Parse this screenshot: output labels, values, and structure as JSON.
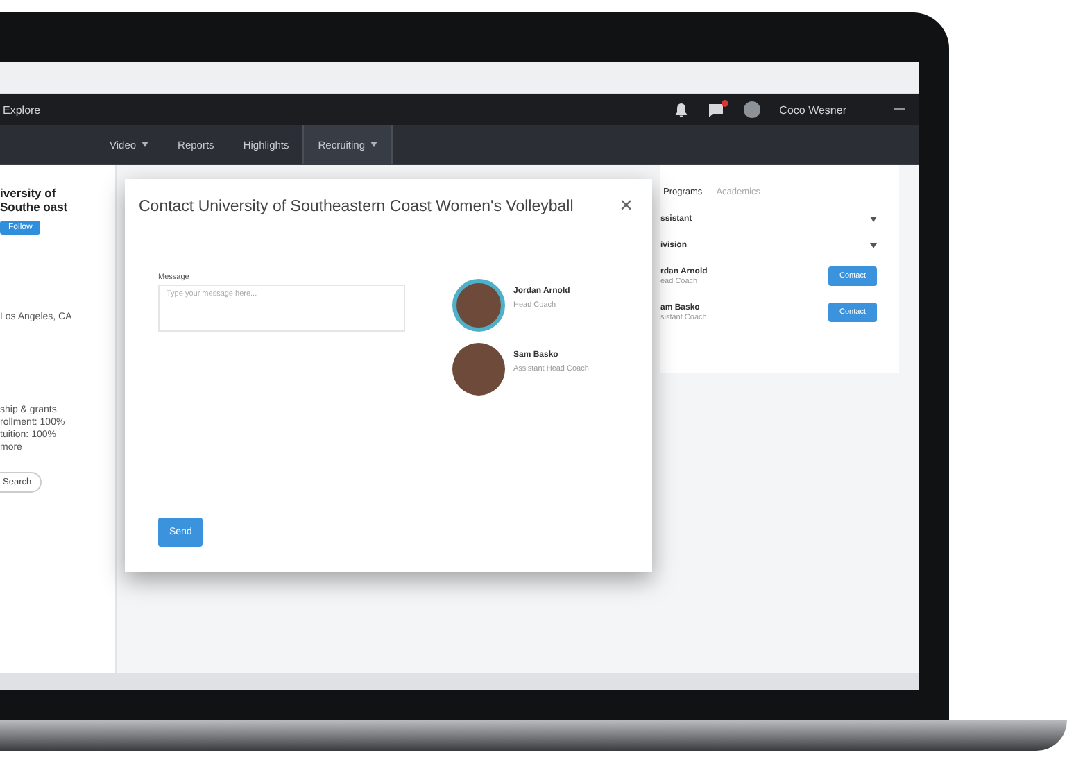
{
  "header": {
    "brand": "Explore",
    "user": "Coco Wesner",
    "unread": true
  },
  "nav": {
    "tabs": [
      {
        "label": "Video",
        "dropdown": true,
        "selected": false
      },
      {
        "label": "Reports",
        "dropdown": false,
        "selected": false
      },
      {
        "label": "Highlights",
        "dropdown": false,
        "selected": false
      },
      {
        "label": "Recruiting",
        "dropdown": true,
        "selected": true
      }
    ]
  },
  "left_panel": {
    "title": "iversity of Southe oast",
    "tag": "Follow",
    "address": "Los Angeles, CA",
    "facts": [
      "ship & grants",
      "rollment: 100%",
      "tuition: 100%",
      "more"
    ],
    "button": "Search"
  },
  "right_panel": {
    "tabs": [
      {
        "label": "Programs",
        "selected": true
      },
      {
        "label": "Academics",
        "selected": false
      }
    ],
    "filters": [
      "ssistant",
      "ivision"
    ],
    "contacts": [
      {
        "name": "rdan Arnold",
        "role": "ead Coach",
        "button": "Contact"
      },
      {
        "name": "am Basko",
        "role": "sistant Coach",
        "button": "Contact"
      }
    ]
  },
  "modal": {
    "title": "Contact University of Southeastern Coast Women's Volleyball",
    "close": "×",
    "message_label": "Message",
    "placeholder": "Type your message here...",
    "recipients": [
      {
        "name": "Jordan Arnold",
        "role": "Head Coach",
        "highlighted": true
      },
      {
        "name": "Sam Basko",
        "role": "Assistant Head Coach",
        "highlighted": false
      }
    ],
    "send": "Send"
  }
}
